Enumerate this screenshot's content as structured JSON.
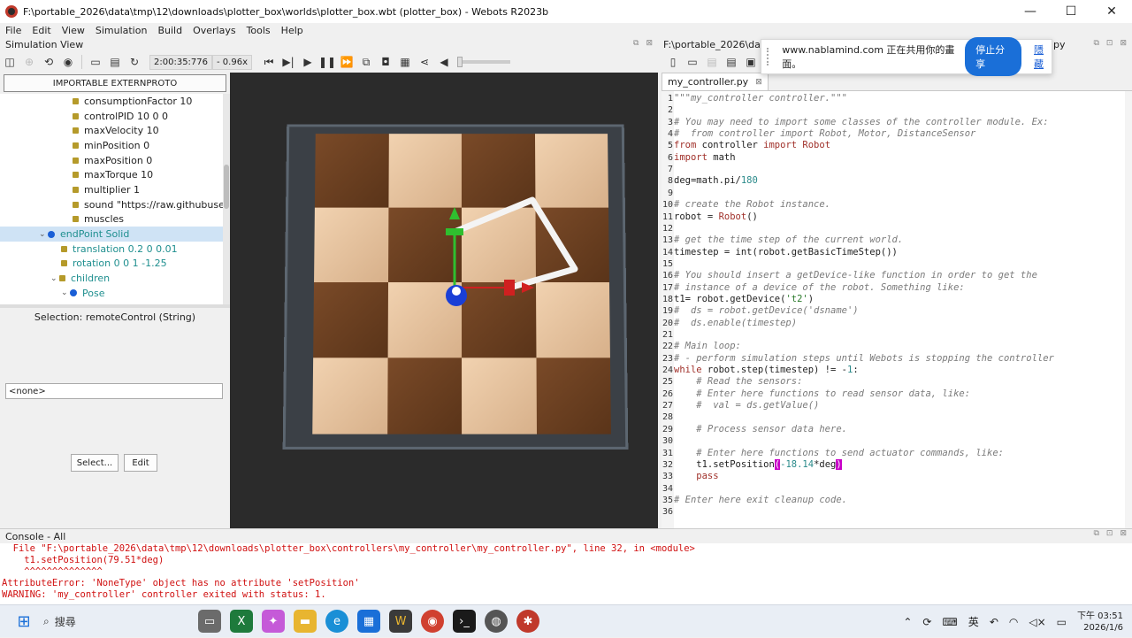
{
  "window": {
    "title": "F:\\portable_2026\\data\\tmp\\12\\downloads\\plotter_box\\worlds\\plotter_box.wbt (plotter_box) - Webots R2023b",
    "minimize": "—",
    "maximize": "☐",
    "close": "✕"
  },
  "menu": [
    "File",
    "Edit",
    "View",
    "Simulation",
    "Build",
    "Overlays",
    "Tools",
    "Help"
  ],
  "simulation_view": {
    "title": "Simulation View",
    "time": "2:00:35:776",
    "speed": "- 0.96x"
  },
  "scene_tree": {
    "extern_button": "IMPORTABLE EXTERNPROTO",
    "rows": [
      {
        "label": "consumptionFactor 10",
        "indent": 4,
        "kind": "field"
      },
      {
        "label": "controlPID 10 0 0",
        "indent": 4,
        "kind": "field"
      },
      {
        "label": "maxVelocity 10",
        "indent": 4,
        "kind": "field"
      },
      {
        "label": "minPosition 0",
        "indent": 4,
        "kind": "field"
      },
      {
        "label": "maxPosition 0",
        "indent": 4,
        "kind": "field"
      },
      {
        "label": "maxTorque 10",
        "indent": 4,
        "kind": "field"
      },
      {
        "label": "multiplier 1",
        "indent": 4,
        "kind": "field"
      },
      {
        "label": "sound \"https://raw.githubusercon",
        "indent": 4,
        "kind": "field"
      },
      {
        "label": "muscles",
        "indent": 4,
        "kind": "field"
      },
      {
        "label": "endPoint Solid",
        "indent": 2,
        "kind": "node-selected"
      },
      {
        "label": "translation 0.2 0 0.01",
        "indent": 3,
        "kind": "field-teal"
      },
      {
        "label": "rotation 0 0 1 -1.25",
        "indent": 3,
        "kind": "field-teal"
      },
      {
        "label": "children",
        "indent": 3,
        "kind": "group-teal"
      },
      {
        "label": "Pose",
        "indent": 4,
        "kind": "node-teal"
      }
    ],
    "selection": "Selection: remoteControl (String)",
    "field_value": "<none>",
    "select_button": "Select...",
    "edit_button": "Edit"
  },
  "editor": {
    "path": "F:\\portable_2026\\data\\t",
    "path_suffix": "r.py",
    "tab": "my_controller.py",
    "tab_close": "⊠",
    "lines": [
      {
        "n": "1",
        "segs": [
          {
            "t": "\"\"\"my_controller controller.\"\"\"",
            "c": "cm"
          }
        ]
      },
      {
        "n": "2",
        "segs": []
      },
      {
        "n": "3",
        "segs": [
          {
            "t": "# You may need to import some classes of the controller module. Ex:",
            "c": "cm"
          }
        ]
      },
      {
        "n": "4",
        "segs": [
          {
            "t": "#  from controller import Robot, Motor, DistanceSensor",
            "c": "cm"
          }
        ]
      },
      {
        "n": "5",
        "segs": [
          {
            "t": "from",
            "c": "kw"
          },
          {
            "t": " controller ",
            "c": ""
          },
          {
            "t": "import",
            "c": "kw"
          },
          {
            "t": " Robot",
            "c": "kw"
          }
        ]
      },
      {
        "n": "6",
        "segs": [
          {
            "t": "import",
            "c": "kw"
          },
          {
            "t": " math",
            "c": ""
          }
        ]
      },
      {
        "n": "7",
        "segs": []
      },
      {
        "n": "8",
        "segs": [
          {
            "t": "deg=math.pi/",
            "c": ""
          },
          {
            "t": "180",
            "c": "num"
          }
        ]
      },
      {
        "n": "9",
        "segs": []
      },
      {
        "n": "10",
        "segs": [
          {
            "t": "# create the Robot instance.",
            "c": "cm"
          }
        ]
      },
      {
        "n": "11",
        "segs": [
          {
            "t": "robot = ",
            "c": ""
          },
          {
            "t": "Robot",
            "c": "kw"
          },
          {
            "t": "()",
            "c": ""
          }
        ]
      },
      {
        "n": "12",
        "segs": []
      },
      {
        "n": "13",
        "segs": [
          {
            "t": "# get the time step of the current world.",
            "c": "cm"
          }
        ]
      },
      {
        "n": "14",
        "segs": [
          {
            "t": "timestep = int(robot.getBasicTimeStep())",
            "c": ""
          }
        ]
      },
      {
        "n": "15",
        "segs": []
      },
      {
        "n": "16",
        "segs": [
          {
            "t": "# You should insert a getDevice-like function in order to get the",
            "c": "cm"
          }
        ]
      },
      {
        "n": "17",
        "segs": [
          {
            "t": "# instance of a device of the robot. Something like:",
            "c": "cm"
          }
        ]
      },
      {
        "n": "18",
        "segs": [
          {
            "t": "t1= robot.getDevice(",
            "c": ""
          },
          {
            "t": "'t2'",
            "c": "str"
          },
          {
            "t": ")",
            "c": ""
          }
        ]
      },
      {
        "n": "19",
        "segs": [
          {
            "t": "#  ds = robot.getDevice('dsname')",
            "c": "cm"
          }
        ]
      },
      {
        "n": "20",
        "segs": [
          {
            "t": "#  ds.enable(timestep)",
            "c": "cm"
          }
        ]
      },
      {
        "n": "21",
        "segs": []
      },
      {
        "n": "22",
        "segs": [
          {
            "t": "# Main loop:",
            "c": "cm"
          }
        ]
      },
      {
        "n": "23",
        "segs": [
          {
            "t": "# - perform simulation steps until Webots is stopping the controller",
            "c": "cm"
          }
        ]
      },
      {
        "n": "24",
        "segs": [
          {
            "t": "while",
            "c": "kw"
          },
          {
            "t": " robot.step(timestep) != -",
            "c": ""
          },
          {
            "t": "1",
            "c": "num"
          },
          {
            "t": ":",
            "c": ""
          }
        ]
      },
      {
        "n": "25",
        "segs": [
          {
            "t": "    # Read the sensors:",
            "c": "cm"
          }
        ]
      },
      {
        "n": "26",
        "segs": [
          {
            "t": "    # Enter here functions to read sensor data, like:",
            "c": "cm"
          }
        ]
      },
      {
        "n": "27",
        "segs": [
          {
            "t": "    #  val = ds.getValue()",
            "c": "cm"
          }
        ]
      },
      {
        "n": "28",
        "segs": []
      },
      {
        "n": "29",
        "segs": [
          {
            "t": "    # Process sensor data here.",
            "c": "cm"
          }
        ]
      },
      {
        "n": "30",
        "segs": []
      },
      {
        "n": "31",
        "segs": [
          {
            "t": "    # Enter here functions to send actuator commands, like:",
            "c": "cm"
          }
        ]
      },
      {
        "n": "32",
        "segs": [
          {
            "t": "    t1.setPosition",
            "c": ""
          },
          {
            "t": "(",
            "c": "hl"
          },
          {
            "t": "-18.14",
            "c": "num"
          },
          {
            "t": "*deg",
            "c": ""
          },
          {
            "t": ")",
            "c": "hl"
          }
        ]
      },
      {
        "n": "33",
        "segs": [
          {
            "t": "    pass",
            "c": "kw"
          }
        ]
      },
      {
        "n": "34",
        "segs": []
      },
      {
        "n": "35",
        "segs": [
          {
            "t": "# Enter here exit cleanup code.",
            "c": "cm"
          }
        ]
      },
      {
        "n": "36",
        "segs": []
      }
    ]
  },
  "share_popup": {
    "text": "www.nablamind.com 正在共用你的畫面。",
    "stop_button": "停止分享",
    "hide_link": "隱藏"
  },
  "console": {
    "title": "Console - All",
    "lines": [
      "  File \"F:\\portable_2026\\data\\tmp\\12\\downloads\\plotter_box\\controllers\\my_controller\\my_controller.py\", line 32, in <module>",
      "    t1.setPosition(79.51*deg)",
      "    ^^^^^^^^^^^^^^",
      "AttributeError: 'NoneType' object has no attribute 'setPosition'",
      "WARNING: 'my_controller' controller exited with status: 1."
    ]
  },
  "taskbar": {
    "search_placeholder": "搜尋",
    "ime": "英",
    "time": "下午 03:51",
    "date": "2026/1/6"
  },
  "colors": {
    "accent": "#1a6fd8",
    "error": "#d01010",
    "selection": "#cfe3f5"
  }
}
